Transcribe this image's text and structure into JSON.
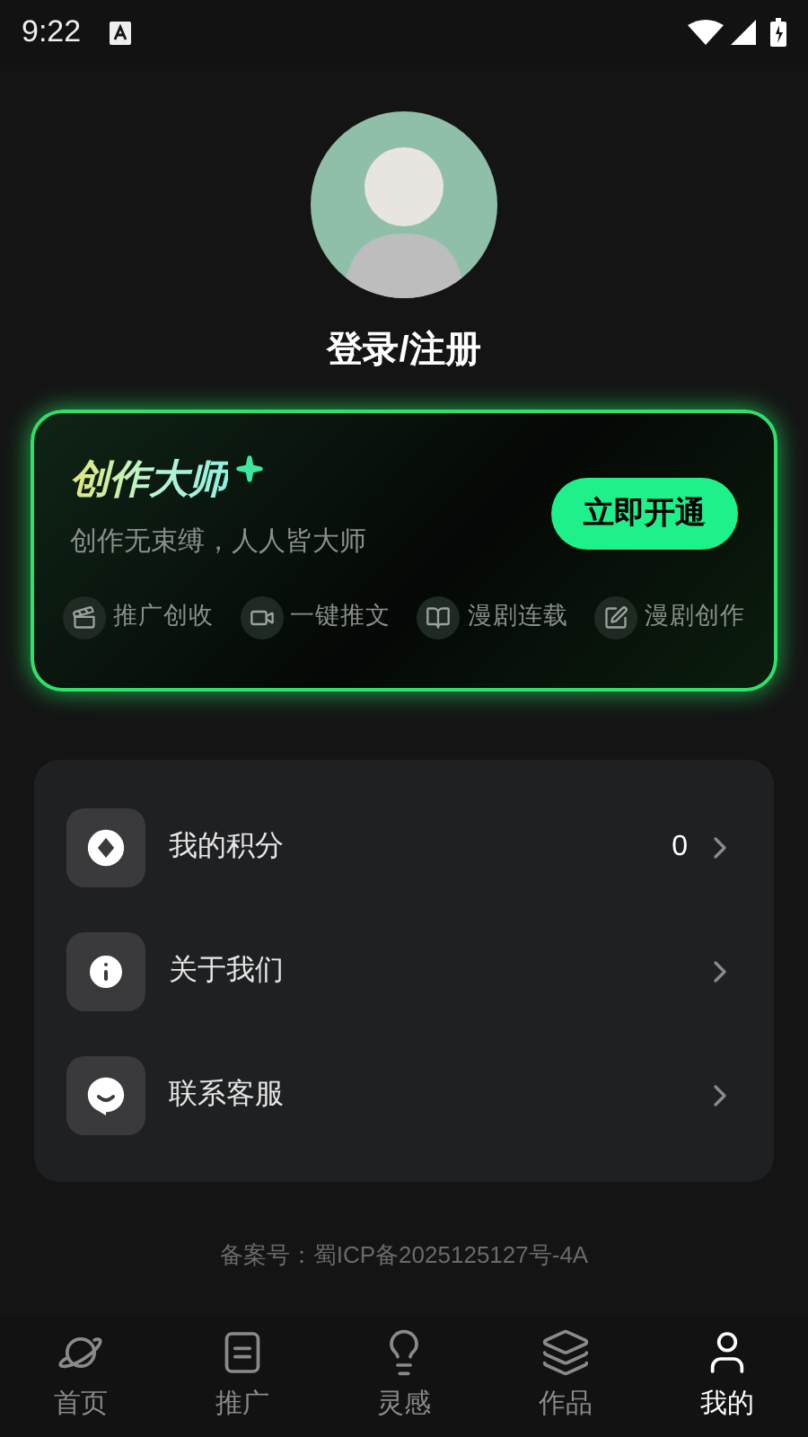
{
  "status_bar": {
    "time": "9:22"
  },
  "profile": {
    "login_label": "登录/注册"
  },
  "vip_card": {
    "title": "创作大师",
    "subtitle": "创作无束缚，人人皆大师",
    "button": "立即开通",
    "features": [
      {
        "kind": "promo",
        "label": "推广创收"
      },
      {
        "kind": "video",
        "label": "一键推文"
      },
      {
        "kind": "serial",
        "label": "漫剧连载"
      },
      {
        "kind": "create",
        "label": "漫剧创作"
      }
    ]
  },
  "menu": [
    {
      "kind": "points",
      "label": "我的积分",
      "value": "0"
    },
    {
      "kind": "about",
      "label": "关于我们"
    },
    {
      "kind": "service",
      "label": "联系客服"
    }
  ],
  "icp": "备案号：蜀ICP备2025125127号-4A",
  "tabs": [
    {
      "kind": "home",
      "label": "首页",
      "selected": false
    },
    {
      "kind": "promo",
      "label": "推广",
      "selected": false
    },
    {
      "kind": "idea",
      "label": "灵感",
      "selected": false
    },
    {
      "kind": "works",
      "label": "作品",
      "selected": false
    },
    {
      "kind": "me",
      "label": "我的",
      "selected": true
    }
  ]
}
